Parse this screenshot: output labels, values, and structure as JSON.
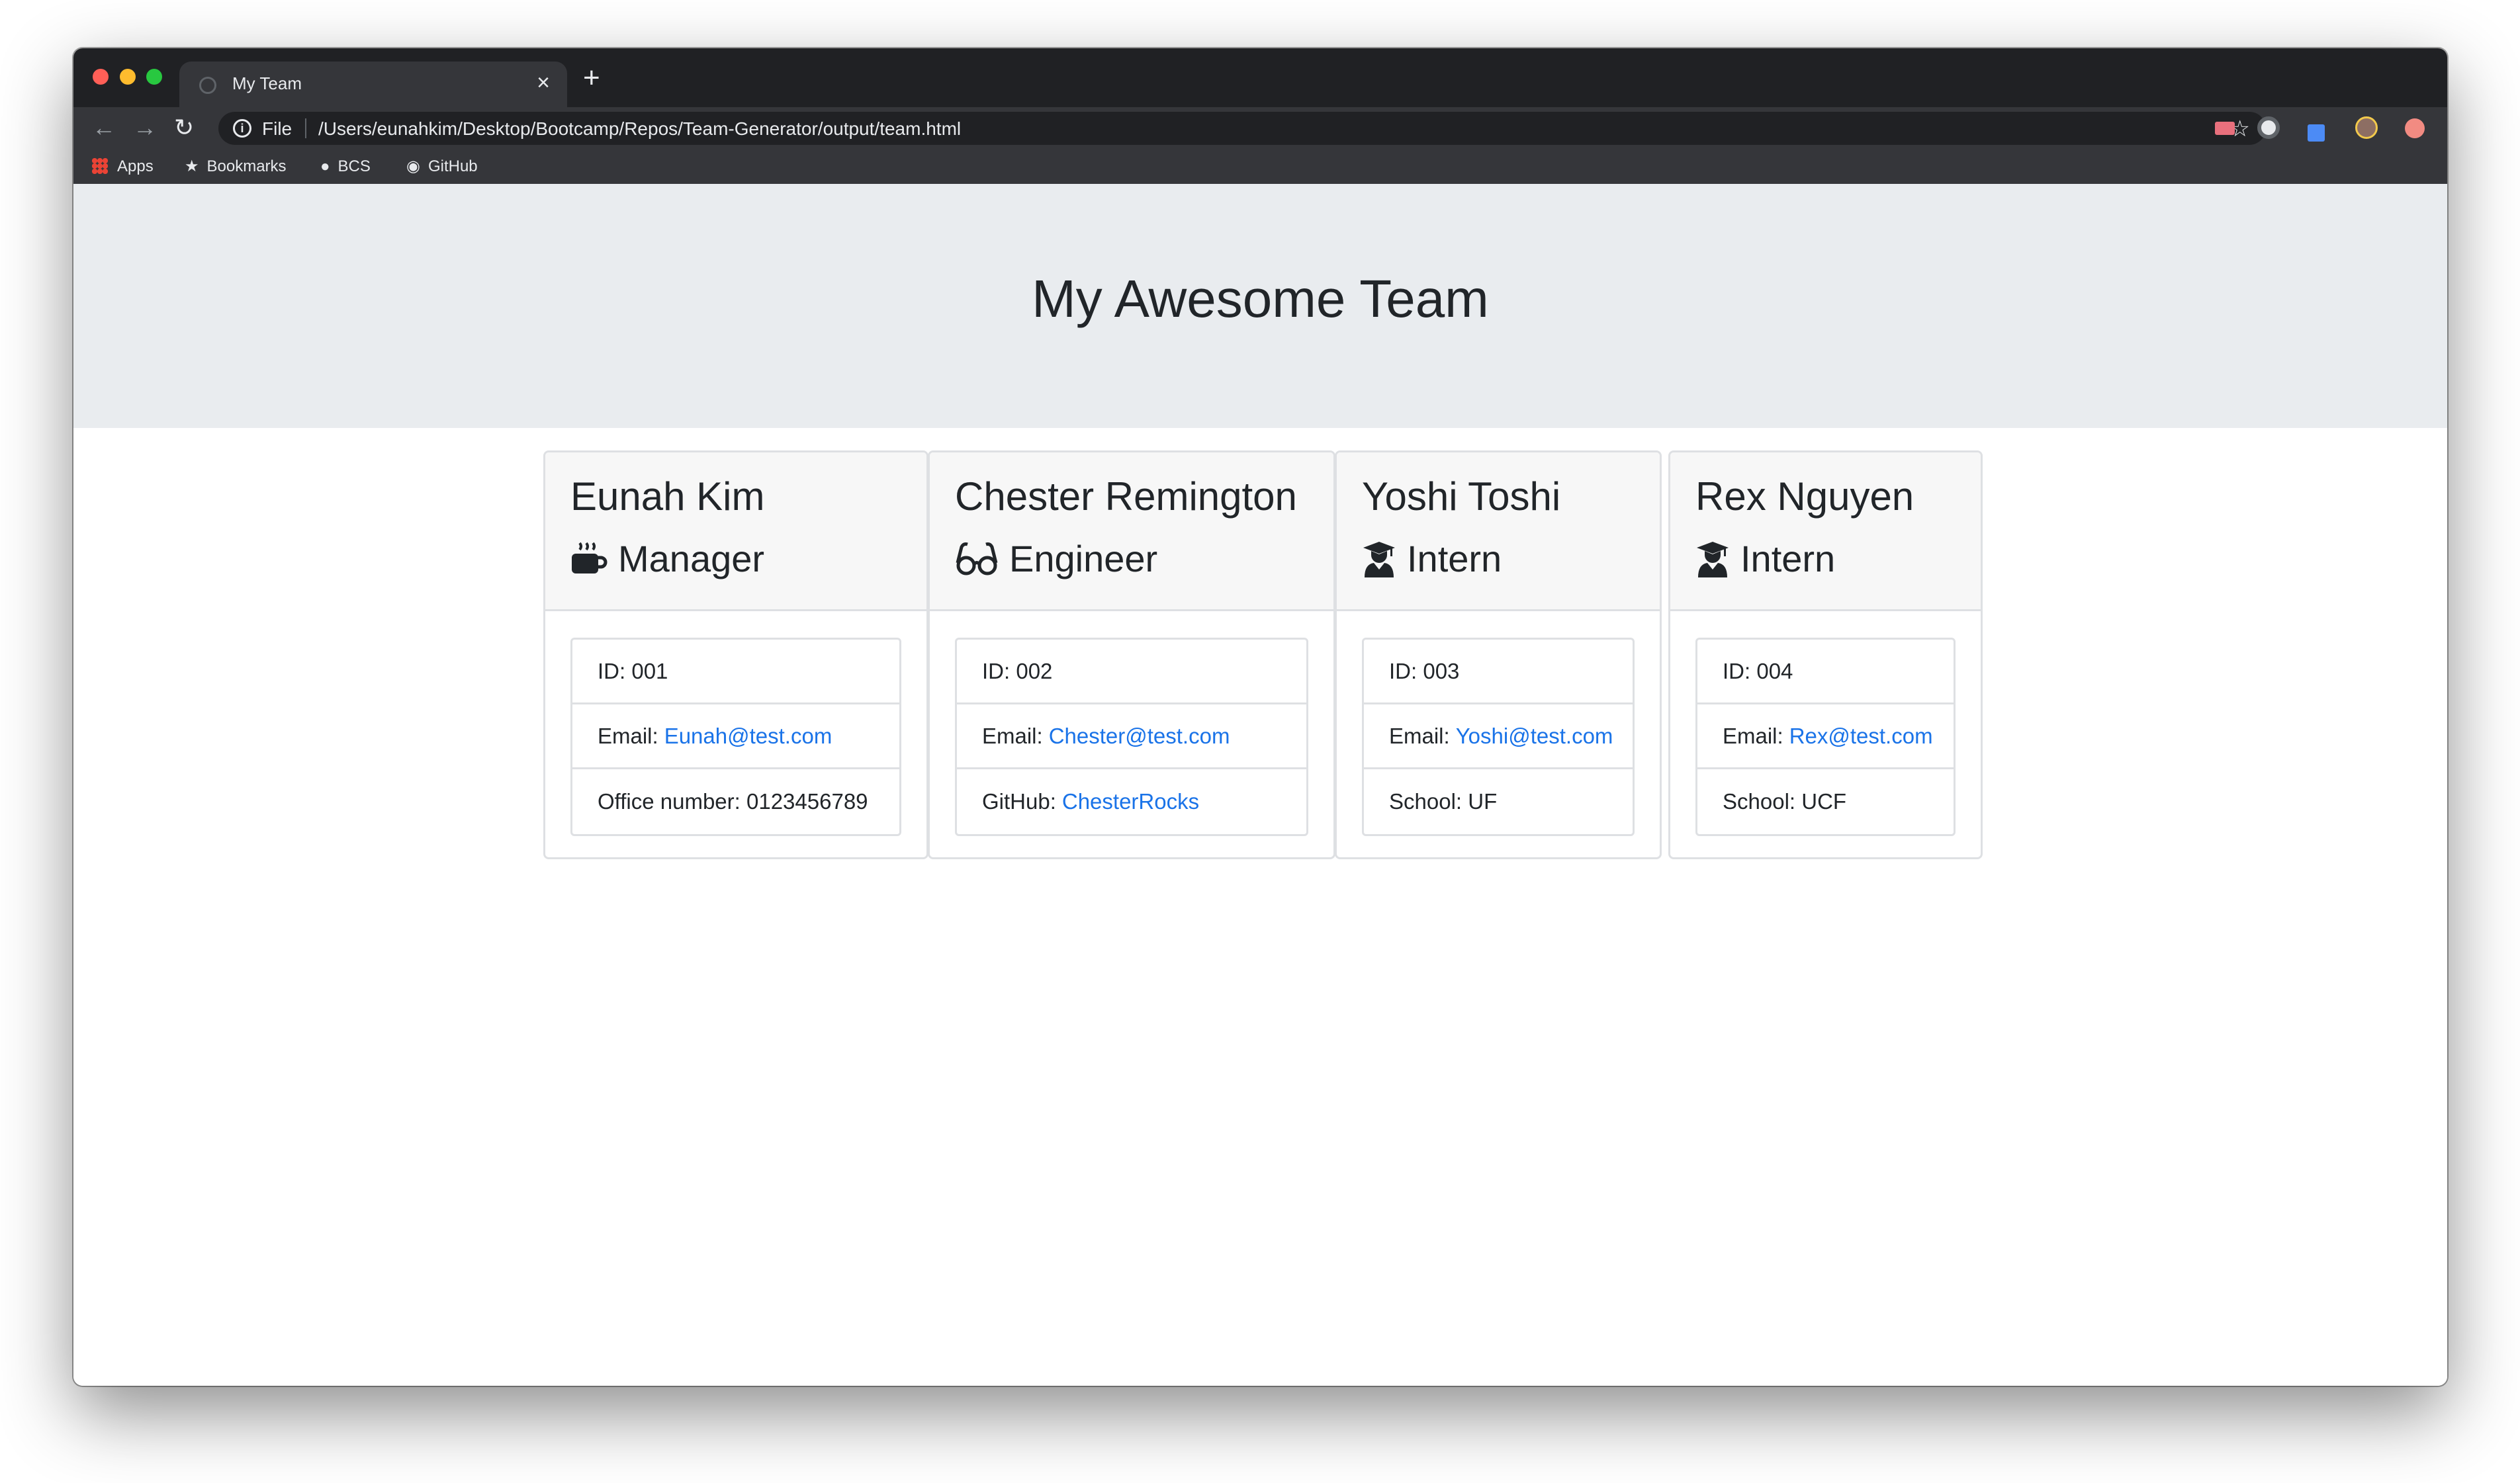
{
  "browser": {
    "tab_title": "My Team",
    "tab_close": "×",
    "new_tab": "+",
    "scheme": "File",
    "url": "/Users/eunahkim/Desktop/Bootcamp/Repos/Team-Generator/output/team.html",
    "bookmarks": [
      {
        "label": "Apps",
        "icon": "apps-grid-icon"
      },
      {
        "label": "Bookmarks",
        "icon": "star-icon"
      },
      {
        "label": "BCS",
        "icon": "globe-icon"
      },
      {
        "label": "GitHub",
        "icon": "github-icon"
      }
    ]
  },
  "page": {
    "title": "My Awesome Team"
  },
  "colors": {
    "jumbotron": "#e9ecef",
    "link": "#1a73e8",
    "card_header": "#f7f7f7",
    "border": "#dee0e3"
  },
  "team": [
    {
      "name": "Eunah Kim",
      "role": "Manager",
      "icon": "mug-icon",
      "id_label": "ID: 001",
      "email_label": "Email:",
      "email": "Eunah@test.com",
      "extra_label": "Office number: 0123456789",
      "extra_link": ""
    },
    {
      "name": "Chester Remington",
      "role": "Engineer",
      "icon": "glasses-icon",
      "id_label": "ID: 002",
      "email_label": "Email:",
      "email": "Chester@test.com",
      "extra_label": "GitHub:",
      "extra_link": "ChesterRocks"
    },
    {
      "name": "Yoshi Toshi",
      "role": "Intern",
      "icon": "graduate-icon",
      "id_label": "ID: 003",
      "email_label": "Email:",
      "email": "Yoshi@test.com",
      "extra_label": "School: UF",
      "extra_link": ""
    },
    {
      "name": "Rex Nguyen",
      "role": "Intern",
      "icon": "graduate-icon",
      "id_label": "ID: 004",
      "email_label": "Email:",
      "email": "Rex@test.com",
      "extra_label": "School: UCF",
      "extra_link": ""
    }
  ]
}
